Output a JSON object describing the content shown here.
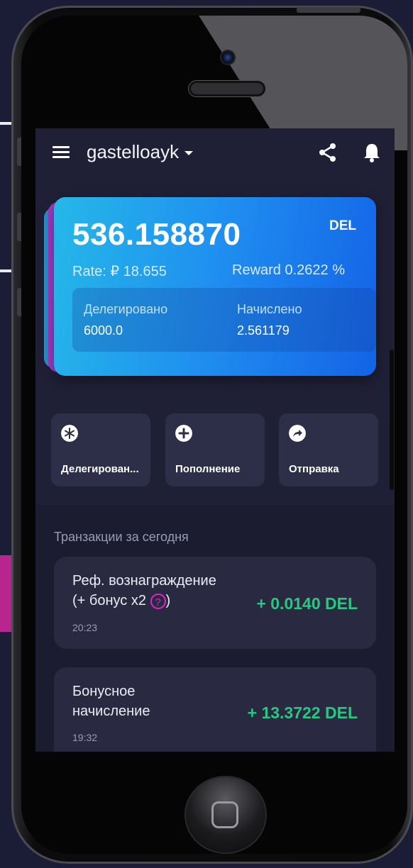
{
  "appbar": {
    "account": "gastelloayk"
  },
  "card": {
    "balance": "536.158870",
    "coin": "DEL",
    "rate": "Rate: ₽ 18.655",
    "reward": "Reward 0.2622 %",
    "delegated_label": "Делегировано",
    "delegated_value": "6000.0",
    "accrued_label": "Начислено",
    "accrued_value": "2.561179"
  },
  "actions": [
    {
      "label": "Делегирован...",
      "icon": "snowflake-icon"
    },
    {
      "label": "Пополнение",
      "icon": "plus-circle-icon"
    },
    {
      "label": "Отправка",
      "icon": "send-arrow-icon"
    }
  ],
  "transactions": {
    "title": "Транзакции за сегодня",
    "items": [
      {
        "line1": "Реф. вознаграждение",
        "line2": "(+ бонус x2",
        "line2_end": ")",
        "help": "?",
        "amount": "+ 0.0140 DEL",
        "time": "20:23"
      },
      {
        "line1": "Бонусное",
        "line2": "начисление",
        "amount": "+ 13.3722 DEL",
        "time": "19:32"
      }
    ]
  },
  "colors": {
    "background": "#1b1c36",
    "screen": "#1f2036",
    "card_gradient_start": "#25b8e8",
    "card_gradient_end": "#1463e6",
    "positive_amount": "#28c880",
    "help_accent": "#d928c4"
  }
}
